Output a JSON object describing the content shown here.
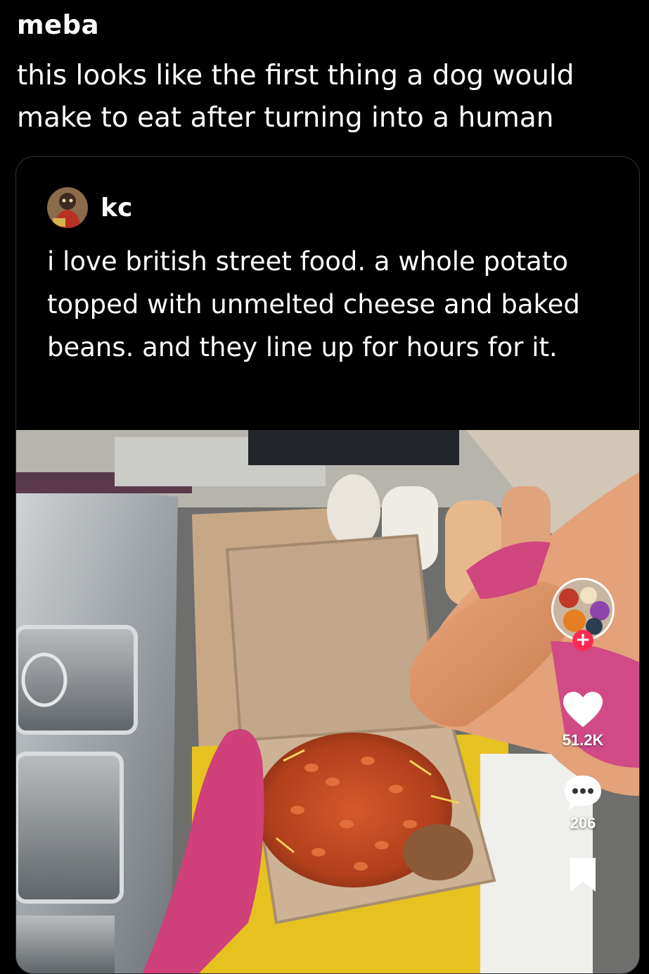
{
  "post": {
    "author": "meba",
    "text": "this looks like the first thing a dog would make to eat after turning into a human"
  },
  "quote": {
    "author": "kc",
    "text": "i love british street food. a whole potato topped with unmelted cheese and baked beans. and they line up for hours for it."
  },
  "video": {
    "follow_symbol": "+",
    "like_count": "51.2K",
    "comment_count": "206",
    "icons": {
      "like": "heart-icon",
      "comment": "comment-bubble-icon",
      "save": "bookmark-icon"
    }
  },
  "colors": {
    "background": "#000000",
    "text": "#ffffff",
    "follow_badge": "#fe2c55",
    "card_border": "#2f3336"
  }
}
